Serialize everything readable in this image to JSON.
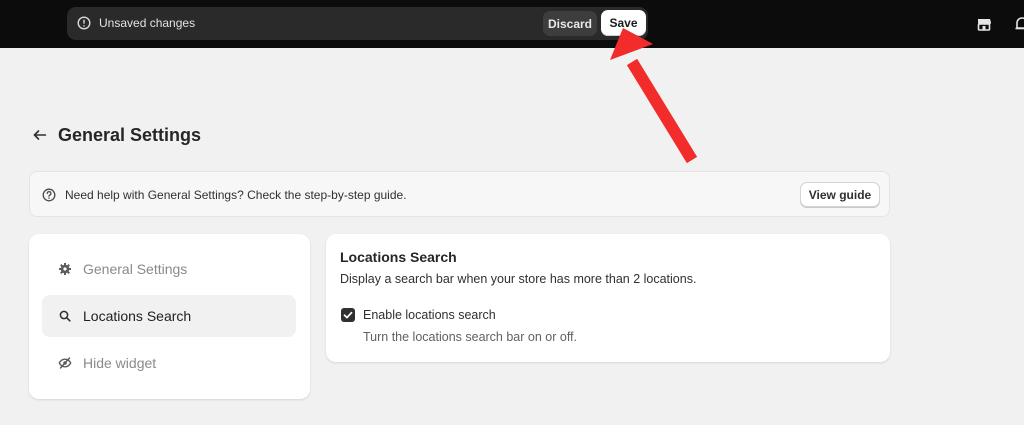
{
  "save_bar": {
    "message": "Unsaved changes",
    "discard_label": "Discard",
    "save_label": "Save"
  },
  "topbar_icons": [
    "store-icon",
    "bell-icon"
  ],
  "page": {
    "title": "General Settings"
  },
  "help_banner": {
    "text": "Need help with General Settings? Check the step-by-step guide.",
    "button_label": "View guide"
  },
  "sidebar": {
    "items": [
      {
        "label": "General Settings",
        "icon": "gear-icon",
        "active": false
      },
      {
        "label": "Locations Search",
        "icon": "search-icon",
        "active": true
      },
      {
        "label": "Hide widget",
        "icon": "eye-off-icon",
        "active": false
      }
    ]
  },
  "locations_search": {
    "title": "Locations Search",
    "description": "Display a search bar when your store has more than 2 locations.",
    "checkbox_label": "Enable locations search",
    "checkbox_checked": true,
    "checkbox_help": "Turn the locations search bar on or off."
  },
  "colors": {
    "topbar": "#0c0c0c",
    "page_background": "#f1f1f1",
    "annotation_arrow": "#f22b2b"
  }
}
